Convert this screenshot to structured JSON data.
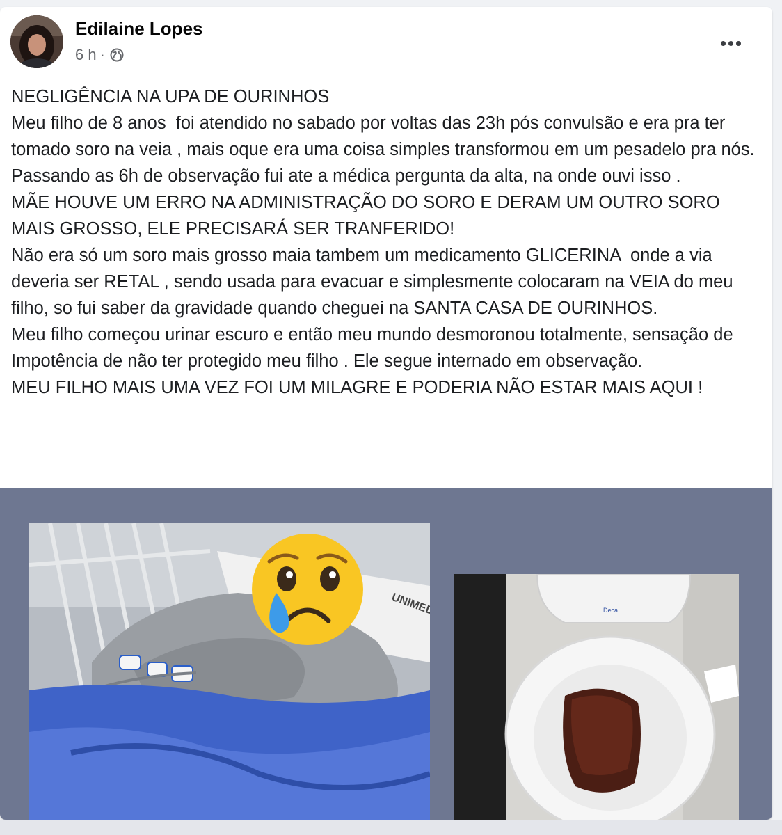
{
  "post": {
    "author_name": "Edilaine Lopes",
    "timestamp": "6 h",
    "separator": "·",
    "privacy_icon": "globe-icon",
    "more_icon": "more-options-icon",
    "paragraphs": [
      "NEGLIGÊNCIA NA UPA DE OURINHOS",
      "Meu filho de 8 anos  foi atendido no sabado por voltas das 23h pós convulsão e era pra ter tomado soro na veia , mais oque era uma coisa simples transformou em um pesadelo pra nós. Passando as 6h de observação fui ate a médica pergunta da alta, na onde ouvi isso .",
      "MÃE HOUVE UM ERRO NA ADMINISTRAÇÃO DO SORO E DERAM UM OUTRO SORO MAIS GROSSO, ELE PRECISARÁ SER TRANFERIDO!",
      "Não era só um soro mais grosso maia tambem um medicamento GLICERINA  onde a via deveria ser RETAL , sendo usada para evacuar e simplesmente colocaram na VEIA do meu filho, so fui saber da gravidade quando cheguei na SANTA CASA DE OURINHOS.",
      "Meu filho começou urinar escuro e então meu mundo desmoronou totalmente, sensação de Impotência de não ter protegido meu filho . Ele segue internado em observação.",
      "MEU FILHO MAIS UMA VEZ FOI UM MILAGRE E PODERIA NÃO ESTAR MAIS AQUI !"
    ],
    "photo1_caption_text": "UNIMED",
    "photo2_brand_text": "Deca"
  },
  "colors": {
    "media_background": "#6e7791",
    "author_text": "#050505",
    "meta_text": "#65676b",
    "body_text": "#1c1e21",
    "blanket_blue": "#3f63c8",
    "emoji_yellow": "#f9c623"
  }
}
